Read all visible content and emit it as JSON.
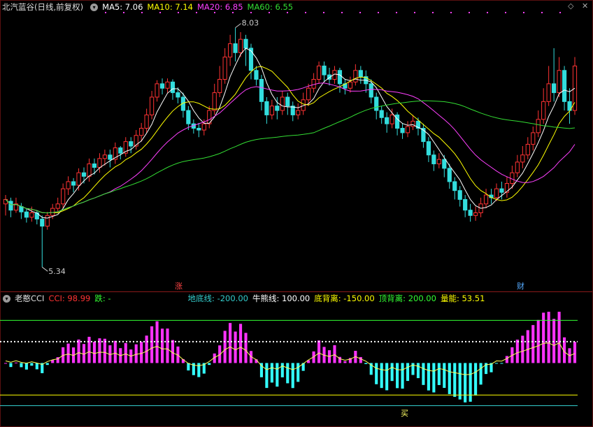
{
  "top_panel": {
    "stock_title": "北汽蓝谷(日线,前复权)",
    "indicators": [
      {
        "label": "MA5: 7.06",
        "color": "#ffffff"
      },
      {
        "label": "MA10: 7.14",
        "color": "#ffff00"
      },
      {
        "label": "MA20: 6.85",
        "color": "#ff40ff"
      },
      {
        "label": "MA60: 6.55",
        "color": "#33dd33"
      }
    ],
    "high_label": "8.03",
    "low_label": "5.34",
    "marker_zhang": "涨",
    "marker_cai": "财",
    "expand_icon": "◇",
    "close_icon": "✕"
  },
  "bottom_panel": {
    "name": "老憨CCI",
    "items": [
      {
        "label": "CCI: 98.99",
        "color": "#ff3333"
      },
      {
        "label": "跌: -",
        "color": "#33ff33"
      },
      {
        "label": "地底线: -200.00",
        "color": "#33cccc"
      },
      {
        "label": "牛熊线: 100.00",
        "color": "#ffffff"
      },
      {
        "label": "底背离: -150.00",
        "color": "#ffff00"
      },
      {
        "label": "顶背离: 200.00",
        "color": "#33ff33"
      },
      {
        "label": "量能: 53.51",
        "color": "#ffff00"
      }
    ],
    "buy_label": "买"
  },
  "chart_data": [
    {
      "type": "candlestick",
      "title": "北汽蓝谷(日线,前复权)",
      "ylim": [
        5.2,
        8.2
      ],
      "high": 8.03,
      "low": 5.34,
      "candles": [
        [
          6.05,
          6.1,
          5.92,
          6.15
        ],
        [
          6.08,
          5.98,
          5.9,
          6.12
        ],
        [
          5.98,
          6.05,
          5.95,
          6.12
        ],
        [
          6.02,
          5.96,
          5.88,
          6.06
        ],
        [
          5.96,
          5.9,
          5.84,
          6.0
        ],
        [
          5.9,
          5.95,
          5.85,
          6.02
        ],
        [
          5.95,
          5.88,
          5.82,
          5.98
        ],
        [
          5.88,
          5.8,
          5.34,
          5.92
        ],
        [
          5.8,
          5.92,
          5.76,
          5.96
        ],
        [
          5.92,
          6.0,
          5.88,
          6.05
        ],
        [
          6.0,
          6.05,
          5.95,
          6.12
        ],
        [
          6.05,
          6.22,
          6.0,
          6.28
        ],
        [
          6.22,
          6.3,
          6.15,
          6.36
        ],
        [
          6.3,
          6.26,
          6.18,
          6.34
        ],
        [
          6.26,
          6.4,
          6.2,
          6.45
        ],
        [
          6.4,
          6.36,
          6.28,
          6.46
        ],
        [
          6.36,
          6.5,
          6.3,
          6.56
        ],
        [
          6.5,
          6.46,
          6.38,
          6.56
        ],
        [
          6.46,
          6.56,
          6.4,
          6.62
        ],
        [
          6.56,
          6.6,
          6.48,
          6.66
        ],
        [
          6.6,
          6.55,
          6.46,
          6.66
        ],
        [
          6.55,
          6.68,
          6.5,
          6.74
        ],
        [
          6.68,
          6.62,
          6.55,
          6.7
        ],
        [
          6.62,
          6.75,
          6.58,
          6.8
        ],
        [
          6.75,
          6.7,
          6.62,
          6.8
        ],
        [
          6.7,
          6.82,
          6.66,
          6.88
        ],
        [
          6.82,
          6.9,
          6.75,
          6.96
        ],
        [
          6.9,
          7.05,
          6.85,
          7.12
        ],
        [
          7.05,
          7.25,
          7.0,
          7.32
        ],
        [
          7.25,
          7.4,
          7.2,
          7.44
        ],
        [
          7.4,
          7.35,
          7.28,
          7.46
        ],
        [
          7.35,
          7.42,
          7.3,
          7.46
        ],
        [
          7.42,
          7.3,
          7.22,
          7.45
        ],
        [
          7.3,
          7.25,
          7.18,
          7.36
        ],
        [
          7.25,
          7.1,
          7.02,
          7.3
        ],
        [
          7.1,
          6.95,
          6.88,
          7.15
        ],
        [
          6.95,
          6.9,
          6.84,
          7.0
        ],
        [
          6.9,
          6.88,
          6.8,
          6.96
        ],
        [
          6.88,
          6.95,
          6.82,
          7.0
        ],
        [
          6.95,
          7.1,
          6.9,
          7.15
        ],
        [
          7.1,
          7.3,
          7.05,
          7.4
        ],
        [
          7.3,
          7.45,
          7.25,
          7.6
        ],
        [
          7.45,
          7.7,
          7.4,
          7.8
        ],
        [
          7.7,
          7.85,
          7.6,
          7.95
        ],
        [
          7.85,
          7.75,
          7.65,
          8.03
        ],
        [
          7.75,
          7.9,
          7.7,
          7.98
        ],
        [
          7.9,
          7.8,
          7.6,
          7.95
        ],
        [
          7.8,
          7.55,
          7.45,
          7.85
        ],
        [
          7.55,
          7.45,
          7.38,
          7.6
        ],
        [
          7.45,
          7.2,
          7.1,
          7.5
        ],
        [
          7.2,
          7.05,
          6.95,
          7.25
        ],
        [
          7.05,
          7.15,
          7.0,
          7.22
        ],
        [
          7.15,
          7.1,
          7.0,
          7.25
        ],
        [
          7.1,
          7.25,
          7.05,
          7.32
        ],
        [
          7.25,
          7.15,
          7.05,
          7.3
        ],
        [
          7.15,
          7.05,
          6.98,
          7.2
        ],
        [
          7.05,
          7.1,
          7.0,
          7.18
        ],
        [
          7.1,
          7.22,
          7.05,
          7.3
        ],
        [
          7.22,
          7.35,
          7.15,
          7.4
        ],
        [
          7.35,
          7.45,
          7.3,
          7.52
        ],
        [
          7.45,
          7.6,
          7.4,
          7.65
        ],
        [
          7.6,
          7.5,
          7.42,
          7.65
        ],
        [
          7.5,
          7.45,
          7.38,
          7.58
        ],
        [
          7.45,
          7.55,
          7.4,
          7.6
        ],
        [
          7.55,
          7.4,
          7.3,
          7.58
        ],
        [
          7.4,
          7.35,
          7.28,
          7.45
        ],
        [
          7.35,
          7.42,
          7.3,
          7.48
        ],
        [
          7.42,
          7.55,
          7.38,
          7.62
        ],
        [
          7.55,
          7.48,
          7.4,
          7.6
        ],
        [
          7.48,
          7.4,
          7.3,
          7.55
        ],
        [
          7.4,
          7.25,
          7.18,
          7.45
        ],
        [
          7.25,
          7.1,
          7.0,
          7.3
        ],
        [
          7.1,
          7.02,
          6.95,
          7.15
        ],
        [
          7.02,
          6.95,
          6.85,
          7.08
        ],
        [
          6.95,
          7.05,
          6.9,
          7.12
        ],
        [
          7.05,
          6.9,
          6.82,
          7.08
        ],
        [
          6.9,
          6.85,
          6.78,
          6.96
        ],
        [
          6.85,
          6.92,
          6.8,
          6.98
        ],
        [
          6.92,
          6.98,
          6.88,
          7.05
        ],
        [
          6.98,
          6.9,
          6.82,
          7.02
        ],
        [
          6.9,
          6.75,
          6.68,
          6.95
        ],
        [
          6.75,
          6.6,
          6.52,
          6.8
        ],
        [
          6.6,
          6.5,
          6.42,
          6.65
        ],
        [
          6.5,
          6.55,
          6.45,
          6.62
        ],
        [
          6.55,
          6.45,
          6.35,
          6.6
        ],
        [
          6.45,
          6.3,
          6.22,
          6.5
        ],
        [
          6.3,
          6.2,
          6.1,
          6.35
        ],
        [
          6.2,
          6.1,
          6.02,
          6.25
        ],
        [
          6.1,
          5.98,
          5.9,
          6.15
        ],
        [
          5.98,
          5.92,
          5.85,
          6.05
        ],
        [
          5.92,
          5.95,
          5.86,
          6.02
        ],
        [
          5.95,
          6.05,
          5.9,
          6.12
        ],
        [
          6.05,
          6.15,
          6.0,
          6.22
        ],
        [
          6.15,
          6.12,
          6.05,
          6.22
        ],
        [
          6.12,
          6.22,
          6.08,
          6.28
        ],
        [
          6.22,
          6.18,
          6.1,
          6.3
        ],
        [
          6.18,
          6.28,
          6.12,
          6.36
        ],
        [
          6.28,
          6.4,
          6.22,
          6.48
        ],
        [
          6.4,
          6.52,
          6.35,
          6.6
        ],
        [
          6.52,
          6.6,
          6.45,
          6.7
        ],
        [
          6.6,
          6.72,
          6.55,
          6.8
        ],
        [
          6.72,
          6.85,
          6.65,
          6.92
        ],
        [
          6.85,
          7.0,
          6.8,
          7.1
        ],
        [
          7.0,
          7.2,
          6.95,
          7.35
        ],
        [
          7.2,
          7.4,
          7.15,
          7.6
        ],
        [
          7.4,
          7.3,
          7.2,
          7.8
        ],
        [
          7.3,
          7.55,
          7.25,
          7.7
        ],
        [
          7.55,
          7.2,
          7.1,
          7.6
        ],
        [
          7.2,
          7.1,
          6.95,
          7.35
        ],
        [
          7.1,
          7.6,
          7.05,
          7.7
        ]
      ],
      "series": [
        {
          "name": "MA5",
          "color": "#ffffff"
        },
        {
          "name": "MA10",
          "color": "#ffff00"
        },
        {
          "name": "MA20",
          "color": "#ff40ff"
        },
        {
          "name": "MA60",
          "color": "#33dd33"
        }
      ]
    },
    {
      "type": "bar",
      "title": "老憨CCI",
      "ylim": [
        -280,
        260
      ],
      "reference_lines": [
        {
          "name": "地底线",
          "value": -200,
          "color": "#33cccc"
        },
        {
          "name": "牛熊线",
          "value": 100,
          "color": "#ffffff"
        },
        {
          "name": "底背离",
          "value": -150,
          "color": "#ffff00"
        },
        {
          "name": "顶背离",
          "value": 200,
          "color": "#33ff33"
        }
      ],
      "last_cci": 98.99,
      "last_energy": 53.51
    }
  ]
}
